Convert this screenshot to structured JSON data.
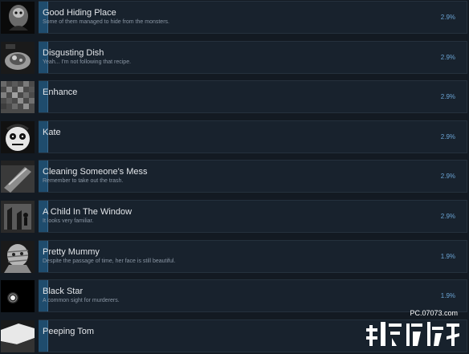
{
  "achievements": [
    {
      "title": "Good Hiding Place",
      "description": "Some of them managed to hide from the monsters.",
      "percent": "2.9%",
      "icon": "creature-icon"
    },
    {
      "title": "Disgusting Dish",
      "description": "Yeah... I'm not following that recipe.",
      "percent": "2.9%",
      "icon": "dish-icon"
    },
    {
      "title": "Enhance",
      "description": "",
      "percent": "2.9%",
      "icon": "pixelated-image-icon"
    },
    {
      "title": "Kate",
      "description": "",
      "percent": "2.9%",
      "icon": "doll-face-icon"
    },
    {
      "title": "Cleaning Someone's Mess",
      "description": "Remember to take out the trash.",
      "percent": "2.9%",
      "icon": "trash-bag-icon"
    },
    {
      "title": "A Child In The Window",
      "description": "It looks very familiar.",
      "percent": "2.9%",
      "icon": "window-child-icon"
    },
    {
      "title": "Pretty Mummy",
      "description": "Despite the passage of time, her face is still beautiful.",
      "percent": "1.9%",
      "icon": "mummy-icon"
    },
    {
      "title": "Black Star",
      "description": "A common sight for murderers.",
      "percent": "1.9%",
      "icon": "black-star-icon"
    },
    {
      "title": "Peeping Tom",
      "description": "",
      "percent": "",
      "icon": "peeping-eye-icon"
    }
  ],
  "watermark": {
    "url": "PC.07073.com",
    "text": "单机游戏"
  },
  "colors": {
    "background": "#131a22",
    "panel": "#18222d",
    "progress_bar": "#1f4c6d",
    "percent_text": "#6aa3d3"
  }
}
